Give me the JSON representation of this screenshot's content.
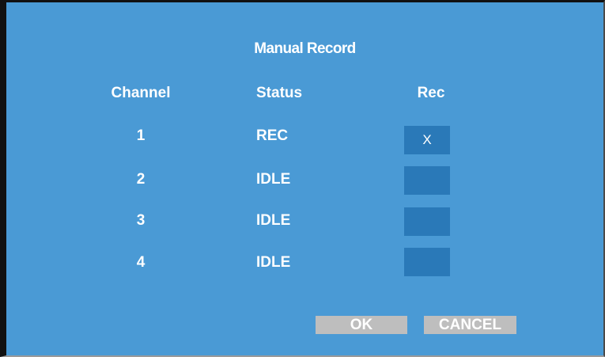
{
  "dialog": {
    "title": "Manual Record",
    "headers": {
      "channel": "Channel",
      "status": "Status",
      "rec": "Rec"
    },
    "rows": [
      {
        "channel": "1",
        "status": "REC",
        "rec_mark": "X",
        "rec_checked": true
      },
      {
        "channel": "2",
        "status": "IDLE",
        "rec_mark": "",
        "rec_checked": false
      },
      {
        "channel": "3",
        "status": "IDLE",
        "rec_mark": "",
        "rec_checked": false
      },
      {
        "channel": "4",
        "status": "IDLE",
        "rec_mark": "",
        "rec_checked": false
      }
    ],
    "buttons": {
      "ok": "OK",
      "cancel": "CANCEL"
    }
  },
  "colors": {
    "background": "#4a9ad5",
    "rec_box": "#2a79b8",
    "button": "#bebebe",
    "text": "#ffffff"
  }
}
